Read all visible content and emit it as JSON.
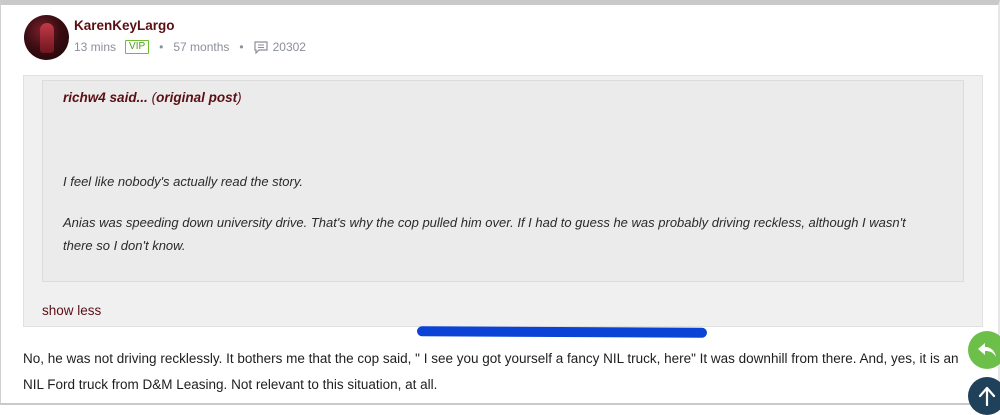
{
  "post": {
    "username": "KarenKeyLargo",
    "time_ago": "13 mins",
    "badge": "VIP",
    "tenure": "57 months",
    "comment_count": "20302",
    "separator": "•",
    "icons": {
      "avatar": "user-avatar",
      "comments": "comment-icon"
    }
  },
  "quote": {
    "author_name": "richw4",
    "said": "said...",
    "link_open": "(",
    "link_label": "original post",
    "link_close": ")",
    "lines": [
      "I feel like nobody's actually read the story.",
      "Anias was speeding down university drive. That's why the cop pulled him over. If I had to guess he was probably driving reckless, although I wasn't there so I don't know."
    ]
  },
  "toggle": {
    "show_less_label": "show less"
  },
  "reply": {
    "text": "No, he was not driving recklessly. It bothers me that the cop said, \" I see you got yourself a fancy NIL truck, here\" It was downhill from there. And, yes, it is an NIL Ford truck from D&M Leasing. Not relevant to this situation, at all."
  },
  "floating_buttons": {
    "reply_icon": "reply-arrow-icon",
    "up_icon": "arrow-up-icon"
  },
  "colors": {
    "username": "#5b0f14",
    "vip": "#4a9e18",
    "meta": "#8b8f99",
    "highlight": "#0a43d6",
    "reply_fab": "#6cc04a",
    "up_fab": "#1f4159"
  }
}
